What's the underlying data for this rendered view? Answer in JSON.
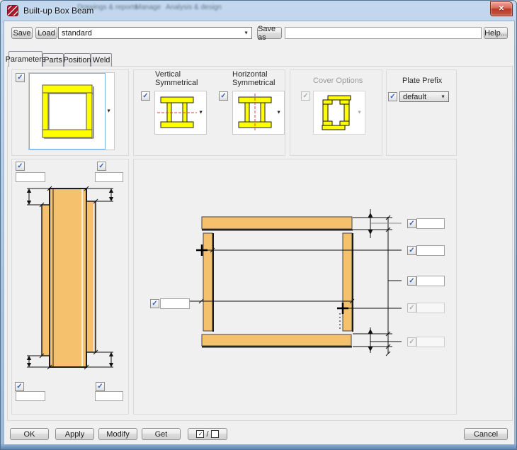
{
  "window": {
    "title": "Built-up Box Beam"
  },
  "background_ribbon": {
    "tabs": [
      "Drawings & reports",
      "Manage",
      "Analysis & design"
    ]
  },
  "toolbar": {
    "save": "Save",
    "load": "Load",
    "profile": "standard",
    "save_as": "Save as",
    "save_as_name": "",
    "help": "Help..."
  },
  "tabs": {
    "items": [
      {
        "label": "Parameters",
        "selected": true
      },
      {
        "label": "Parts",
        "selected": false
      },
      {
        "label": "Position",
        "selected": false
      },
      {
        "label": "Weld",
        "selected": false
      }
    ]
  },
  "options": {
    "preview": {
      "checked": true
    },
    "vertical_symmetrical": {
      "label_1": "Vertical",
      "label_2": "Symmetrical",
      "checked": true
    },
    "horizontal_symmetrical": {
      "label_1": "Horizontal",
      "label_2": "Symmetrical",
      "checked": true
    },
    "cover_options": {
      "label": "Cover Options",
      "checked": true,
      "enabled": false
    },
    "plate_prefix": {
      "label": "Plate Prefix",
      "checked": true,
      "value": "default"
    }
  },
  "left_panel": {
    "fields": [
      {
        "id": "web-offset-top-left",
        "checked": true,
        "value": ""
      },
      {
        "id": "web-offset-top-right",
        "checked": true,
        "value": ""
      },
      {
        "id": "web-offset-bottom-left",
        "checked": true,
        "value": ""
      },
      {
        "id": "web-offset-bottom-right",
        "checked": true,
        "value": ""
      }
    ]
  },
  "main_panel": {
    "left_field": {
      "checked": true,
      "value": ""
    },
    "right_fields": [
      {
        "checked": true,
        "enabled": true,
        "value": ""
      },
      {
        "checked": true,
        "enabled": true,
        "value": ""
      },
      {
        "checked": true,
        "enabled": true,
        "value": ""
      },
      {
        "checked": true,
        "enabled": false,
        "value": ""
      },
      {
        "checked": true,
        "enabled": false,
        "value": ""
      }
    ]
  },
  "footer": {
    "ok": "OK",
    "apply": "Apply",
    "modify": "Modify",
    "get": "Get",
    "toggle_separator": "/",
    "cancel": "Cancel"
  },
  "icons": {
    "check": "✓",
    "dropdown": "▼",
    "close": "✕"
  },
  "colors": {
    "plate_orange": "#f5c16c",
    "plate_yellow": "#ffff00",
    "symmetry_red": "#e23d3d",
    "check_blue": "#3560c4",
    "preview_border": "#74b2e8",
    "close_red": "#c65a45",
    "dialog_bg": "#f0f0f0"
  }
}
